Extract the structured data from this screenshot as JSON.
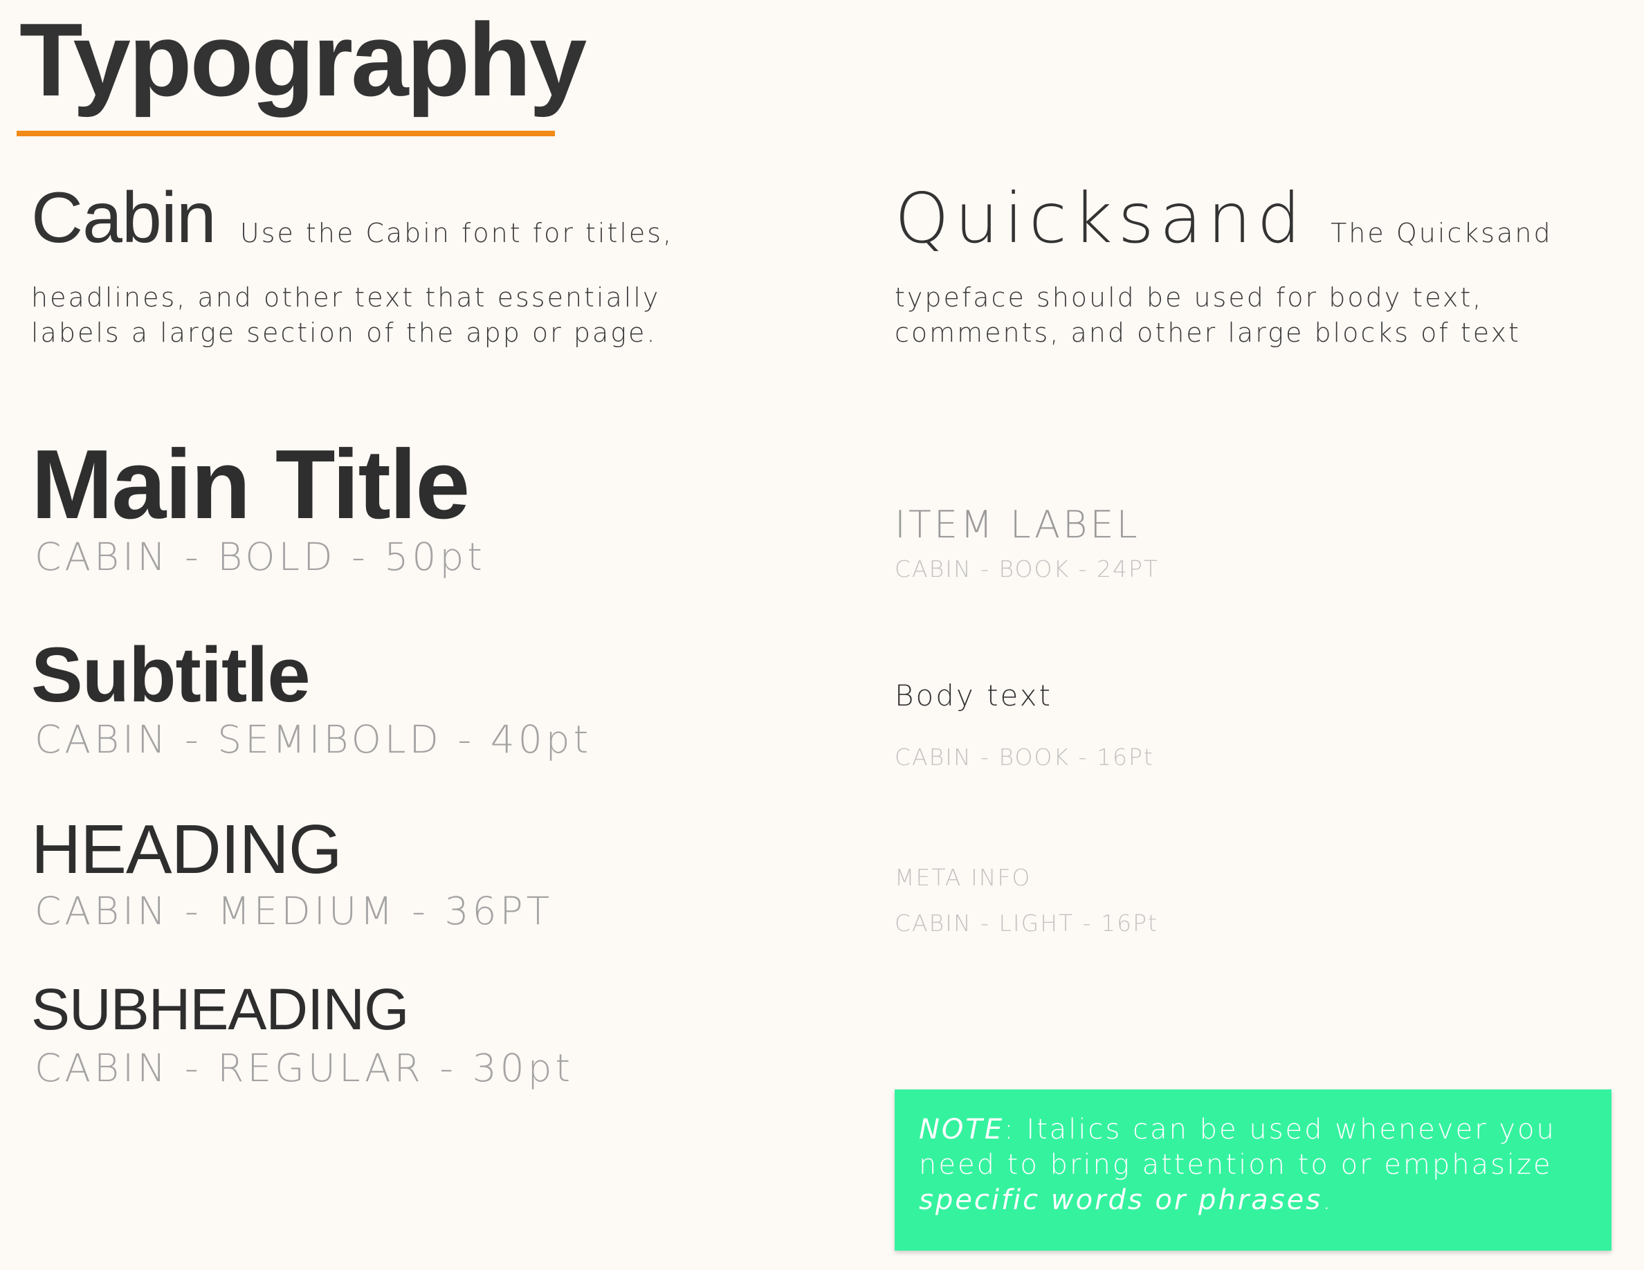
{
  "page": {
    "title": "Typography",
    "accent_color": "#f18a17",
    "background_color": "#fdf9f5"
  },
  "intro": {
    "cabin": {
      "name": "Cabin",
      "lines": [
        "Use the Cabin font for titles,",
        "headlines, and other text that essentially",
        "labels a large section of the app or page."
      ]
    },
    "quicksand": {
      "name": "Quicksand",
      "lines": [
        "The Quicksand",
        "typeface should be used for body text,",
        "comments, and other large blocks of text"
      ]
    }
  },
  "cabin_styles": [
    {
      "sample": "Main Title",
      "spec": "CABIN - BOLD - 50pt"
    },
    {
      "sample": "Subtitle",
      "spec": "CABIN - SEMIBOLD - 40pt"
    },
    {
      "sample": "HEADING",
      "spec": "CABIN - MEDIUM - 36PT"
    },
    {
      "sample": "SUBHEADING",
      "spec": "CABIN - REGULAR - 30pt"
    }
  ],
  "quicksand_styles": [
    {
      "sample": "ITEM LABEL",
      "spec": "CABIN - BOOK - 24PT"
    },
    {
      "sample": "Body text",
      "spec": "CABIN - BOOK - 16Pt"
    },
    {
      "sample": "META INFO",
      "spec": "CABIN - LIGHT - 16Pt"
    }
  ],
  "note": {
    "label": "NOTE",
    "line1_rest": ": Italics can be used whenever you",
    "line2": "need to bring attention to or emphasize",
    "line3_italic": "specific words or phrases",
    "line3_end": ".",
    "background_color": "#35f29f"
  }
}
